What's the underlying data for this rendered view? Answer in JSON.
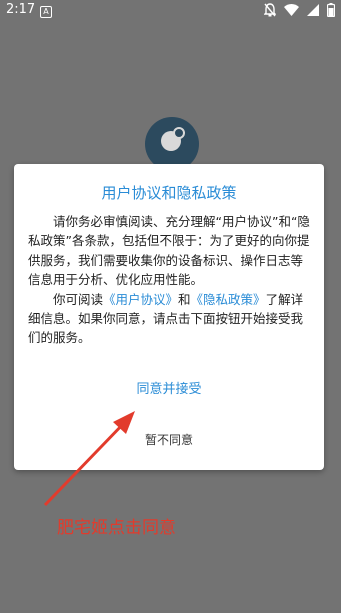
{
  "status_bar": {
    "time": "2:17",
    "notif_letter": "A"
  },
  "dialog": {
    "title": "用户协议和隐私政策",
    "para1": "请你务必审慎阅读、充分理解“用户协议”和“隐私政策”各条款，包括但不限于：为了更好的向你提供服务，我们需要收集你的设备标识、操作日志等信息用于分析、优化应用性能。",
    "para2_prefix": "你可阅读",
    "link_user_agreement": "《用户协议》",
    "para2_and": "和",
    "link_privacy_policy": "《隐私政策》",
    "para2_suffix": "了解详细信息。如果你同意，请点击下面按钮开始接受我们的服务。",
    "agree_button": "同意并接受",
    "disagree_button": "暂不同意"
  },
  "annotation": {
    "text": "肥宅姬点击同意",
    "color": "#e23b2c"
  },
  "colors": {
    "accent": "#2a8cd6",
    "overlay_bg": "#737373"
  }
}
